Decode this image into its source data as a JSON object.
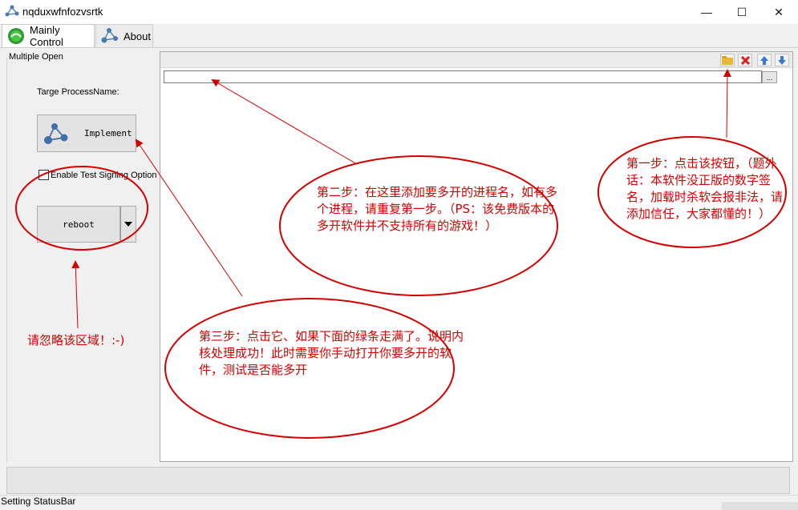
{
  "window": {
    "title": "nqduxwfnfozvsrtk",
    "minimize_glyph": "—",
    "maximize_glyph": "☐",
    "close_glyph": "✕"
  },
  "tabs": [
    {
      "label": "Mainly Control",
      "icon": "green-orb-icon",
      "selected": true
    },
    {
      "label": "About",
      "icon": "molecule-icon",
      "selected": false
    }
  ],
  "left_panel": {
    "group_title": "Multiple Open",
    "process_label": "Targe ProcessName:",
    "implement_label": "Implement",
    "checkbox_label": "Enable Test Signing Option",
    "checkbox_checked": false,
    "reboot_label": "reboot"
  },
  "right_panel": {
    "toolbar": [
      {
        "name": "open-folder-icon",
        "glyph": "📂"
      },
      {
        "name": "delete-icon",
        "glyph": "✕"
      },
      {
        "name": "move-up-icon",
        "glyph": "⬆"
      },
      {
        "name": "move-down-icon",
        "glyph": "⬇"
      }
    ],
    "process_input_value": "",
    "browse_label": "..."
  },
  "status": {
    "text": "Setting StatusBar"
  },
  "annotations": {
    "step1": "第一步：点击该按钮，（题外话：本软件没正版的数字签名，加载时杀软会报非法，请添加信任，大家都懂的！）",
    "step2": "第二步：在这里添加要多开的进程名，如有多个进程，请重复第一步。（PS：该免费版本的多开软件并不支持所有的游戏！）",
    "step3": "第三步：点击它、如果下面的绿条走满了。说明内核处理成功！此时需要你手动打开你要多开的软件，测试是否能多开",
    "ignore": "请忽略该区域！:-)"
  },
  "colors": {
    "annotation_red": "#d40000",
    "window_bg": "#f0f0f0"
  }
}
